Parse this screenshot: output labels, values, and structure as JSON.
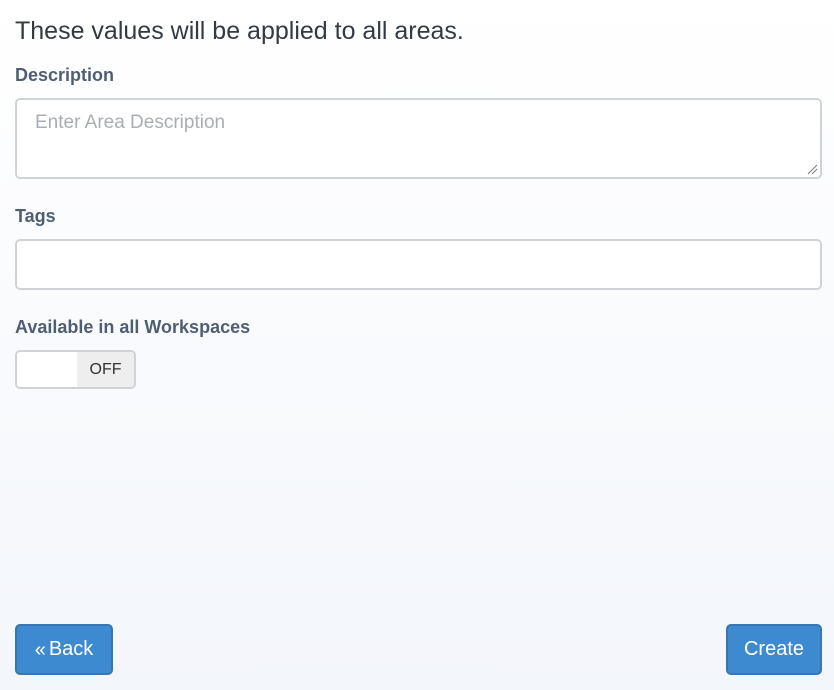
{
  "intro_text": "These values will be applied to all areas.",
  "description": {
    "label": "Description",
    "placeholder": "Enter Area Description",
    "value": ""
  },
  "tags": {
    "label": "Tags",
    "value": ""
  },
  "available_in_all_workspaces": {
    "label": "Available in all Workspaces",
    "state_text": "OFF",
    "enabled": false
  },
  "buttons": {
    "back_label": "Back",
    "back_icon": "double-chevron-left-icon",
    "create_label": "Create"
  },
  "colors": {
    "primary_button": "#3d8ad0",
    "label_text": "#4f5f73"
  }
}
